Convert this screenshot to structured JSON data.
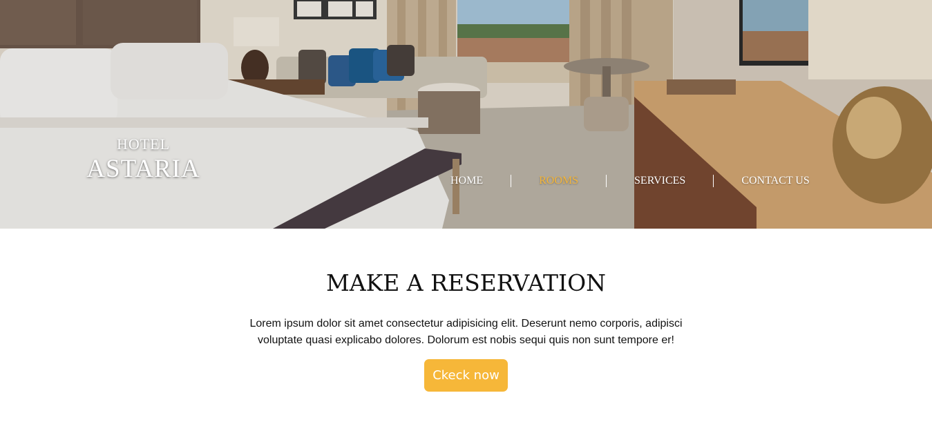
{
  "brand": {
    "line1": "HOTEL",
    "line2": "ASTARIA"
  },
  "nav": {
    "items": [
      {
        "label": "HOME"
      },
      {
        "label": "ROOMS"
      },
      {
        "label": "SERVICES"
      },
      {
        "label": "CONTACT US"
      }
    ],
    "active_index": 1,
    "active_color": "#f4b63a"
  },
  "hero": {
    "image": "hotel-room-photo"
  },
  "reservation": {
    "title": "MAKE A RESERVATION",
    "text": "Lorem ipsum dolor sit amet consectetur adipisicing elit. Deserunt nemo corporis, adipisci voluptate quasi explicabo dolores. Dolorum est nobis sequi quis non sunt tempore er!",
    "button_label": "Ckeck now",
    "button_color": "#f6b739"
  }
}
